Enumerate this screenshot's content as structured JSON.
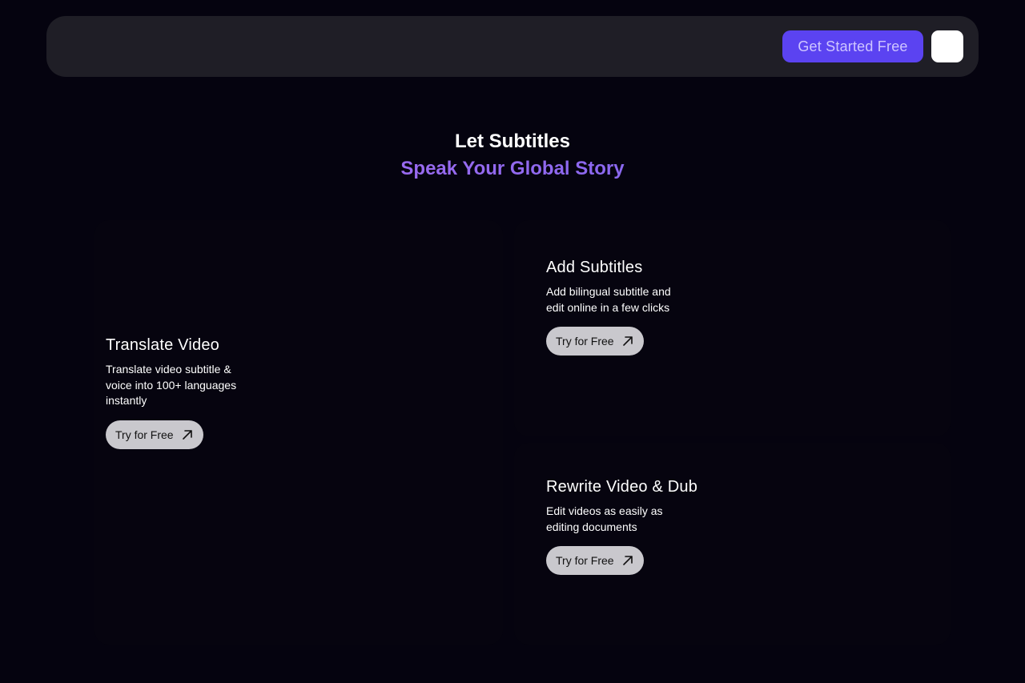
{
  "nav": {
    "cta_label": "Get Started Free"
  },
  "hero": {
    "line1": "Let Subtitles",
    "line2": "Speak Your Global Story"
  },
  "features": [
    {
      "title": "Translate Video",
      "desc_lines": [
        "Translate video subtitle &",
        "voice into 100+ languages",
        "instantly"
      ],
      "button": "Try for Free"
    },
    {
      "title": "Add Subtitles",
      "desc_lines": [
        "Add bilingual subtitle and",
        "edit online in a few clicks"
      ],
      "button": "Try for Free"
    },
    {
      "title": "Rewrite Video & Dub",
      "desc_lines": [
        "Edit videos as easily as",
        "editing documents"
      ],
      "button": "Try for Free"
    }
  ],
  "icons": {
    "try_arrow": "arrow-up-right-icon"
  },
  "colors": {
    "background": "#05030f",
    "navbar": "#1f1e26",
    "cta": "#5b43f1",
    "cta_text": "#cfc6ff",
    "gradient_start": "#b36ef0",
    "gradient_end": "#6f63ef",
    "try_button": "#c9c8cd"
  }
}
